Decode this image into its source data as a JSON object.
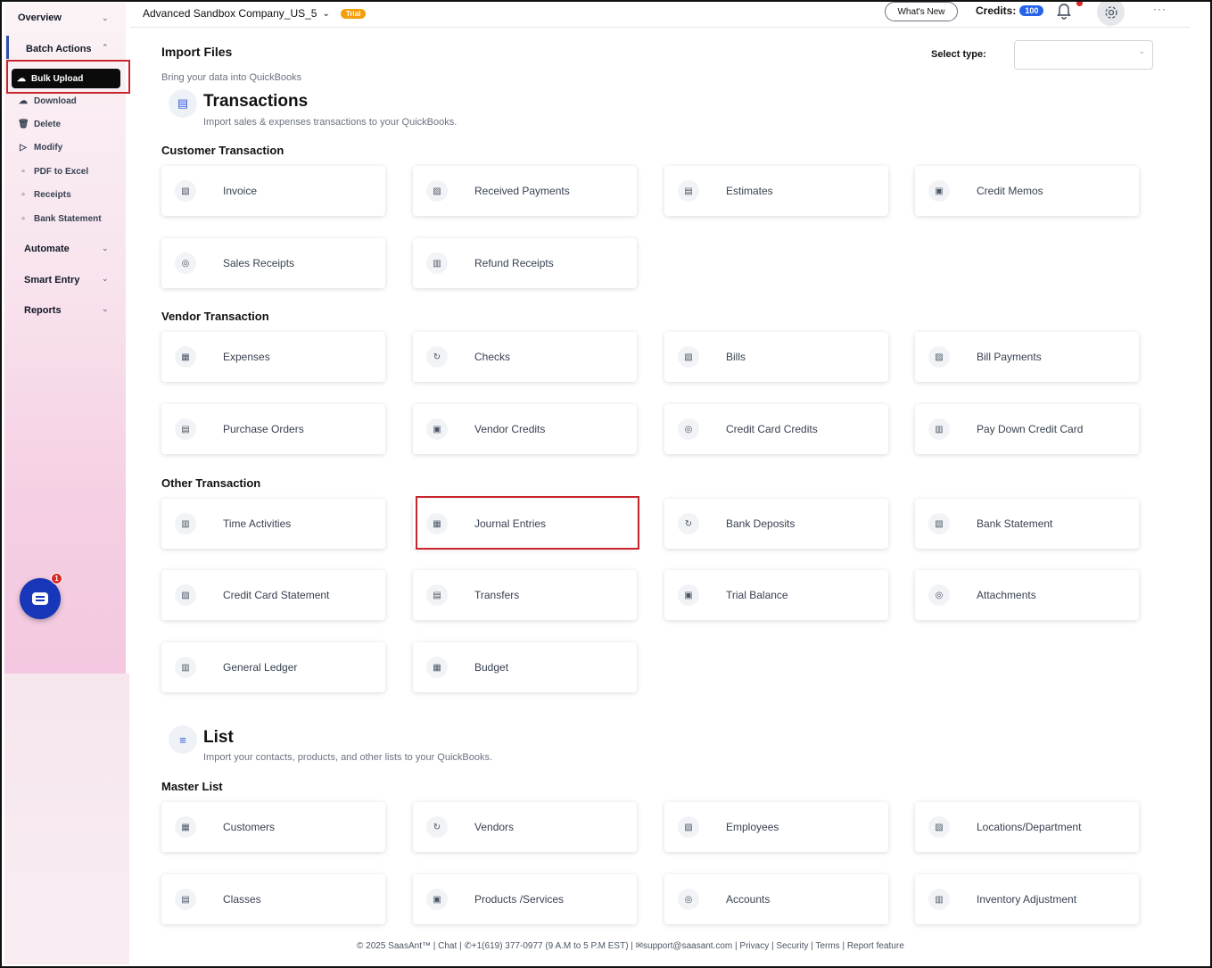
{
  "sidebar": {
    "overview": "Overview",
    "batch_actions": "Batch Actions",
    "bulk_upload": "Bulk Upload",
    "items": [
      {
        "label": "Download",
        "icon": "download-icon"
      },
      {
        "label": "Delete",
        "icon": "trash-icon"
      },
      {
        "label": "Modify",
        "icon": "edit-file-icon"
      },
      {
        "label": "PDF to Excel",
        "icon": "file-icon"
      },
      {
        "label": "Receipts",
        "icon": "receipt-icon"
      },
      {
        "label": "Bank Statement",
        "icon": "file-icon"
      }
    ],
    "automate": "Automate",
    "smart_entry": "Smart Entry",
    "reports": "Reports",
    "chat_badge": "1"
  },
  "header": {
    "company": "Advanced Sandbox Company_US_5",
    "trial": "Trial",
    "whats_new": "What's New",
    "credits_label": "Credits:",
    "credits_value": "100"
  },
  "main": {
    "import_title": "Import Files",
    "import_subtitle": "Bring your data into QuickBooks",
    "select_type_label": "Select type:",
    "transactions": {
      "title": "Transactions",
      "desc": "Import sales & expenses transactions to your QuickBooks."
    },
    "customer_group": "Customer Transaction",
    "customer_cards": [
      "Invoice",
      "Received Payments",
      "Estimates",
      "Credit Memos",
      "Sales Receipts",
      "Refund Receipts"
    ],
    "vendor_group": "Vendor Transaction",
    "vendor_cards": [
      "Expenses",
      "Checks",
      "Bills",
      "Bill Payments",
      "Purchase Orders",
      "Vendor Credits",
      "Credit Card Credits",
      "Pay Down Credit Card"
    ],
    "other_group": "Other Transaction",
    "other_cards": [
      "Time Activities",
      "Journal Entries",
      "Bank Deposits",
      "Bank Statement",
      "Credit Card Statement",
      "Transfers",
      "Trial Balance",
      "Attachments",
      "General Ledger",
      "Budget"
    ],
    "list": {
      "title": "List",
      "desc": "Import your contacts, products, and other lists to your QuickBooks."
    },
    "master_group": "Master List",
    "master_cards": [
      "Customers",
      "Vendors",
      "Employees",
      "Locations/Department",
      "Classes",
      "Products /Services",
      "Accounts",
      "Inventory Adjustment"
    ]
  },
  "footer": {
    "text": "© 2025 SaasAnt™ | Chat | ✆+1(619) 377-0977 (9 A.M to 5 P.M EST) | ✉support@saasant.com | Privacy | Security | Terms | Report feature"
  }
}
